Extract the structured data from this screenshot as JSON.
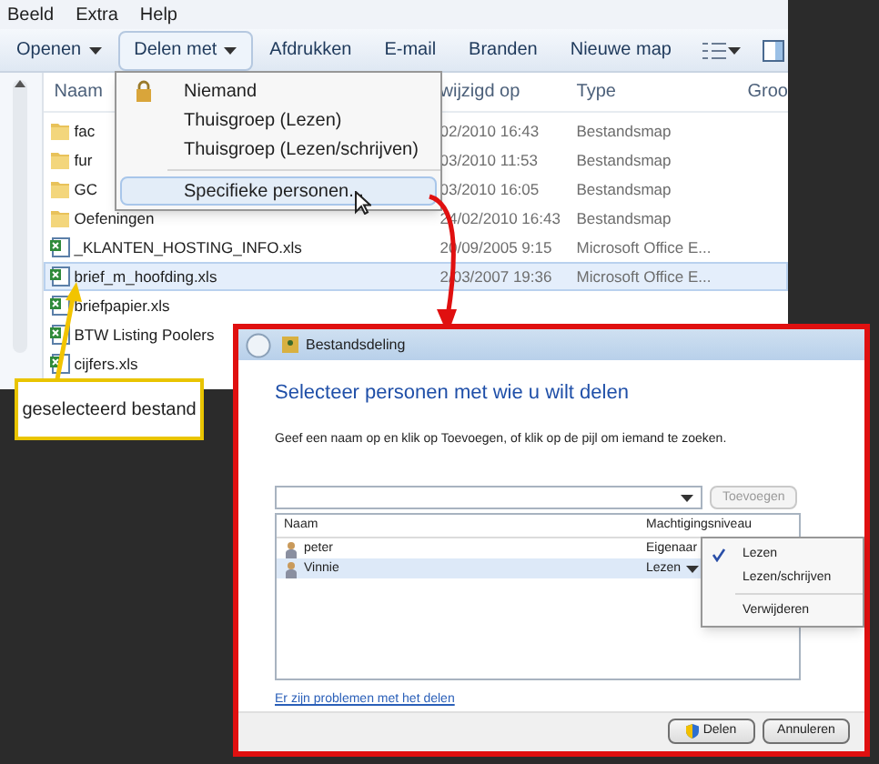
{
  "menu_bar": [
    "Beeld",
    "Extra",
    "Help"
  ],
  "toolbar": [
    {
      "label": "Openen",
      "dropdown": true,
      "hovered": false
    },
    {
      "label": "Delen met",
      "dropdown": true,
      "hovered": true
    },
    {
      "label": "Afdrukken",
      "dropdown": false,
      "hovered": false
    },
    {
      "label": "E-mail",
      "dropdown": false,
      "hovered": false
    },
    {
      "label": "Branden",
      "dropdown": false,
      "hovered": false
    },
    {
      "label": "Nieuwe map",
      "dropdown": false,
      "hovered": false
    }
  ],
  "file_list": {
    "columns": [
      "Naam",
      "wijzigd op",
      "Type",
      "Groo"
    ],
    "rows": [
      {
        "kind": "folder",
        "name": "fac",
        "modified": "02/2010 16:43",
        "type": "Bestandsmap",
        "selected": false
      },
      {
        "kind": "folder",
        "name": "fur",
        "modified": "03/2010 11:53",
        "type": "Bestandsmap",
        "selected": false
      },
      {
        "kind": "folder",
        "name": "GC",
        "modified": "03/2010 16:05",
        "type": "Bestandsmap",
        "selected": false
      },
      {
        "kind": "folder",
        "name": "Oefeningen",
        "modified": "24/02/2010 16:43",
        "type": "Bestandsmap",
        "selected": false
      },
      {
        "kind": "sheet",
        "name": "_KLANTEN_HOSTING_INFO.xls",
        "modified": "20/09/2005 9:15",
        "type": "Microsoft Office E...",
        "selected": false
      },
      {
        "kind": "sheet",
        "name": "brief_m_hoofding.xls",
        "modified": "2/03/2007 19:36",
        "type": "Microsoft Office E...",
        "selected": true
      },
      {
        "kind": "sheet",
        "name": "briefpapier.xls",
        "selected": false
      },
      {
        "kind": "sheet",
        "name": "BTW Listing Poolers",
        "selected": false
      },
      {
        "kind": "sheet",
        "name": "cijfers.xls",
        "selected": false
      }
    ]
  },
  "share_menu": [
    {
      "label": "Niemand",
      "kind": "locked",
      "hovered": false
    },
    {
      "label": "Thuisgroep (Lezen)",
      "kind": "plain",
      "hovered": false
    },
    {
      "label": "Thuisgroep (Lezen/schrijven)",
      "kind": "plain",
      "hovered": false
    },
    {
      "kind": "separator"
    },
    {
      "label": "Specifieke personen...",
      "kind": "plain",
      "hovered": true
    }
  ],
  "callout": "geselecteerd bestand",
  "dialog": {
    "title": "Bestandsdeling",
    "heading": "Selecteer personen met wie u wilt delen",
    "instruction": "Geef een naam op en klik op Toevoegen, of klik op de pijl om iemand te zoeken.",
    "add_button": {
      "label": "Toevoegen",
      "disabled": true
    },
    "people": {
      "columns": [
        "Naam",
        "Machtigingsniveau"
      ],
      "rows": [
        {
          "name": "peter",
          "permission": "Eigenaar",
          "selected": false
        },
        {
          "name": "Vinnie",
          "permission": "Lezen",
          "selected": true
        }
      ]
    },
    "permission_menu": [
      {
        "kind": "option",
        "label": "Lezen",
        "checked": true
      },
      {
        "kind": "option",
        "label": "Lezen/schrijven",
        "checked": false
      },
      {
        "kind": "separator"
      },
      {
        "kind": "option",
        "label": "Verwijderen",
        "checked": false
      }
    ],
    "help_link": "Er zijn problemen met het delen",
    "buttons": [
      {
        "label": "Delen",
        "kind": "shield"
      },
      {
        "label": "Annuleren",
        "kind": "plain"
      }
    ]
  }
}
